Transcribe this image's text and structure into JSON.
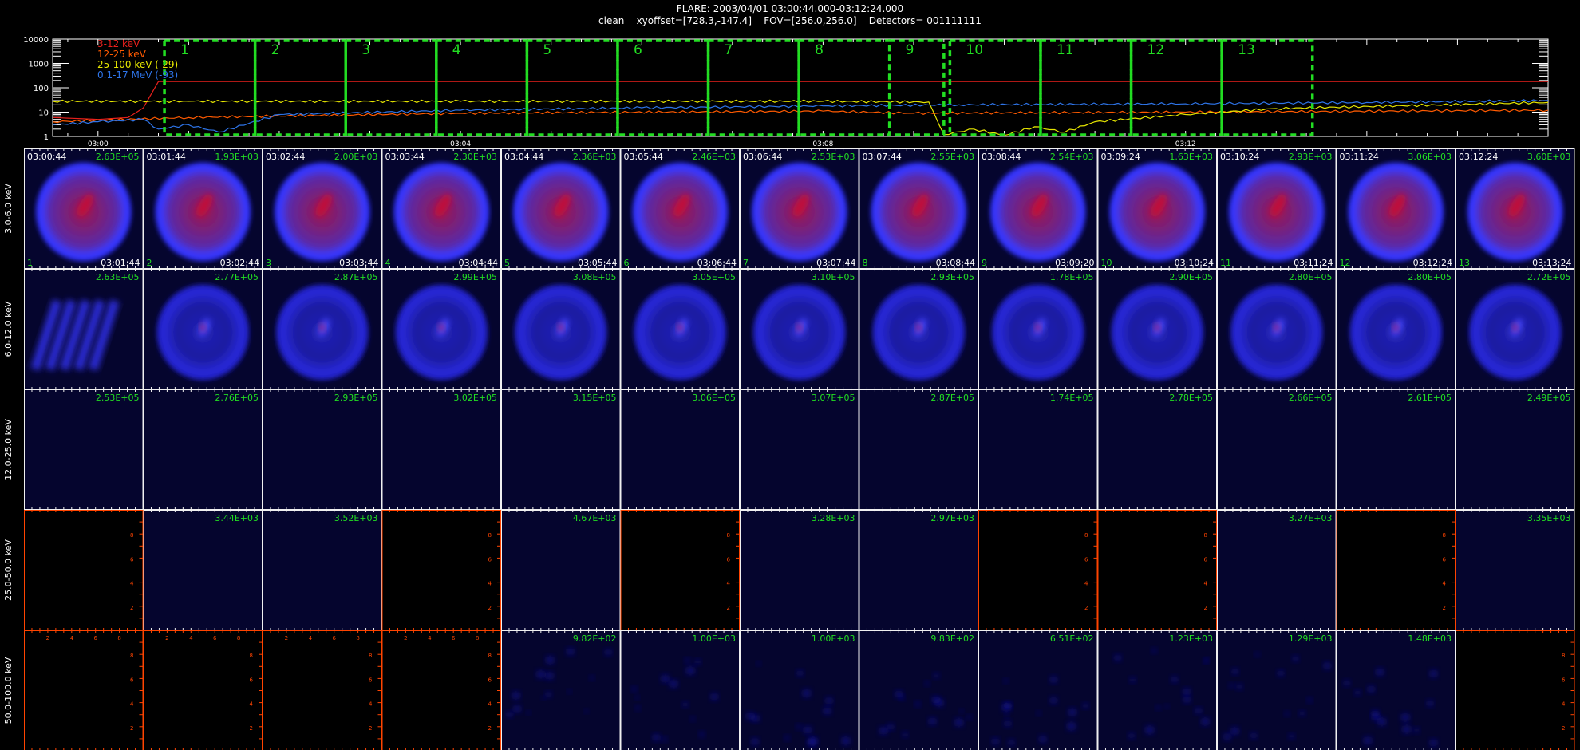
{
  "header": {
    "line1": "FLARE: 2003/04/01 03:00:44.000-03:12:24.000",
    "line2": "clean    xyoffset=[728.3,-147.4]    FOV=[256.0,256.0]    Detectors= 001111111"
  },
  "colors": {
    "axis": "#ffffff",
    "box": "#22dd22",
    "label_green": "#22dd22",
    "frame_orange": "#ff4400",
    "disk_blue": "#2a2aff"
  },
  "chart_data": [
    {
      "type": "line",
      "ylog": true,
      "ylim": [
        1,
        10000
      ],
      "y_ticks": [
        "10000",
        "1000",
        "100",
        "10",
        "1"
      ],
      "xlim": [
        "02:59:30",
        "03:16:00"
      ],
      "x_ticks": [
        "03:00",
        "03:04",
        "03:08",
        "03:12"
      ],
      "legend_position": "top-left",
      "legend": [
        {
          "label": "3-12 keV",
          "color": "#e8201c"
        },
        {
          "label": "12-25 keV",
          "color": "#ff5a00"
        },
        {
          "label": "25-100 keV (-29)",
          "color": "#e6e600"
        },
        {
          "label": "0.1-17 MeV (-93)",
          "color": "#2e74e8"
        }
      ],
      "series": [
        {
          "name": "3-12 keV",
          "color": "#e8201c",
          "x": [
            "02:59:30",
            "03:00:00",
            "03:00:20",
            "03:00:30",
            "03:00:40",
            "03:16:00"
          ],
          "y": [
            6,
            5,
            6,
            15,
            180,
            180
          ]
        },
        {
          "name": "12-25 keV",
          "color": "#ff5a00",
          "x": [
            "02:59:30",
            "03:01:00",
            "03:04:00",
            "03:08:00",
            "03:09:00",
            "03:12:00",
            "03:16:00"
          ],
          "y": [
            4,
            6,
            9,
            11,
            9,
            10,
            12
          ]
        },
        {
          "name": "25-100 keV (-29)",
          "color": "#e6e600",
          "x": [
            "02:59:30",
            "03:01:00",
            "03:04:00",
            "03:08:00",
            "03:09:10",
            "03:09:20",
            "03:09:40",
            "03:10:00",
            "03:10:20",
            "03:10:40",
            "03:11:00",
            "03:12:00",
            "03:13:00",
            "03:16:00"
          ],
          "y": [
            28,
            28,
            28,
            28,
            26,
            1.2,
            2,
            1.1,
            2.5,
            1.5,
            4,
            8,
            14,
            25
          ]
        },
        {
          "name": "0.1-17 MeV (-93)",
          "color": "#2e74e8",
          "x": [
            "02:59:30",
            "03:00:00",
            "03:00:30",
            "03:00:40",
            "03:01:00",
            "03:01:20",
            "03:02:00",
            "03:04:00",
            "03:06:00",
            "03:08:00",
            "03:09:30",
            "03:12:00",
            "03:14:00",
            "03:16:00"
          ],
          "y": [
            3,
            4,
            5,
            2,
            3,
            1.5,
            8,
            12,
            15,
            18,
            20,
            22,
            25,
            30
          ]
        }
      ],
      "intervals": [
        {
          "label": "1",
          "start": "03:00:44",
          "end": "03:01:44"
        },
        {
          "label": "2",
          "start": "03:01:44",
          "end": "03:02:44"
        },
        {
          "label": "3",
          "start": "03:02:44",
          "end": "03:03:44"
        },
        {
          "label": "4",
          "start": "03:03:44",
          "end": "03:04:44"
        },
        {
          "label": "5",
          "start": "03:04:44",
          "end": "03:05:44"
        },
        {
          "label": "6",
          "start": "03:05:44",
          "end": "03:06:44"
        },
        {
          "label": "7",
          "start": "03:06:44",
          "end": "03:07:44"
        },
        {
          "label": "8",
          "start": "03:07:44",
          "end": "03:08:44"
        },
        {
          "label": "9",
          "start": "03:08:44",
          "end": "03:09:20"
        },
        {
          "label": "10",
          "start": "03:09:24",
          "end": "03:10:24"
        },
        {
          "label": "11",
          "start": "03:10:24",
          "end": "03:11:24"
        },
        {
          "label": "12",
          "start": "03:11:24",
          "end": "03:12:24"
        },
        {
          "label": "13",
          "start": "03:12:24",
          "end": "03:13:24"
        }
      ]
    },
    {
      "type": "heatmap",
      "energy_bands": [
        "3.0-6.0 keV",
        "6.0-12.0 keV",
        "12.0-25.0 keV",
        "25.0-50.0 keV",
        "50.0-100.0 keV"
      ],
      "intervals": [
        {
          "index": "1",
          "start": "03:00:44",
          "end": "03:01:44"
        },
        {
          "index": "2",
          "start": "03:01:44",
          "end": "03:02:44"
        },
        {
          "index": "3",
          "start": "03:02:44",
          "end": "03:03:44"
        },
        {
          "index": "4",
          "start": "03:03:44",
          "end": "03:04:44"
        },
        {
          "index": "5",
          "start": "03:04:44",
          "end": "03:05:44"
        },
        {
          "index": "6",
          "start": "03:05:44",
          "end": "03:06:44"
        },
        {
          "index": "7",
          "start": "03:06:44",
          "end": "03:07:44"
        },
        {
          "index": "8",
          "start": "03:07:44",
          "end": "03:08:44"
        },
        {
          "index": "9",
          "start": "03:08:44",
          "end": "03:09:20"
        },
        {
          "index": "10",
          "start": "03:09:24",
          "end": "03:10:24"
        },
        {
          "index": "11",
          "start": "03:10:24",
          "end": "03:11:24"
        },
        {
          "index": "12",
          "start": "03:11:24",
          "end": "03:12:24"
        },
        {
          "index": "13",
          "start": "03:12:24",
          "end": "03:13:24"
        }
      ],
      "max_values": [
        [
          "2.63E+05",
          "1.93E+03",
          "2.00E+03",
          "2.30E+03",
          "2.36E+03",
          "2.46E+03",
          "2.53E+03",
          "2.55E+03",
          "2.54E+03",
          "1.63E+03",
          "2.93E+03",
          "3.06E+03",
          "3.60E+03"
        ],
        [
          "2.63E+05",
          "2.77E+05",
          "2.87E+05",
          "2.99E+05",
          "3.08E+05",
          "3.05E+05",
          "3.10E+05",
          "2.93E+05",
          "1.78E+05",
          "2.90E+05",
          "2.80E+05",
          "2.80E+05",
          "2.72E+05"
        ],
        [
          "2.53E+05",
          "2.76E+05",
          "2.93E+05",
          "3.02E+05",
          "3.15E+05",
          "3.06E+05",
          "3.07E+05",
          "2.87E+05",
          "1.74E+05",
          "2.78E+05",
          "2.66E+05",
          "2.61E+05",
          "2.49E+05"
        ],
        [
          "",
          "3.44E+03",
          "3.52E+03",
          "",
          "4.67E+03",
          "",
          "3.28E+03",
          "2.97E+03",
          "",
          "",
          "3.27E+03",
          "",
          "3.35E+03"
        ],
        [
          "",
          "",
          "",
          "",
          "9.82E+02",
          "1.00E+03",
          "1.00E+03",
          "9.83E+02",
          "6.51E+02",
          "1.23E+03",
          "1.29E+03",
          "1.48E+03",
          ""
        ]
      ],
      "panel_kind": [
        [
          "disk_red",
          "disk_red",
          "disk_red",
          "disk_red",
          "disk_red",
          "disk_red",
          "disk_red",
          "disk_red",
          "disk_red",
          "disk_red",
          "disk_red",
          "disk_red",
          "disk_red"
        ],
        [
          "stripes",
          "disk_blue",
          "disk_blue",
          "disk_blue",
          "disk_blue",
          "disk_blue",
          "disk_blue",
          "disk_blue",
          "disk_blue",
          "disk_blue",
          "disk_blue",
          "disk_blue",
          "disk_blue"
        ],
        [
          "flat",
          "flat",
          "flat",
          "flat",
          "flat",
          "flat",
          "flat",
          "flat",
          "flat",
          "flat",
          "flat",
          "flat",
          "flat"
        ],
        [
          "empty",
          "flat",
          "flat",
          "empty",
          "flat",
          "empty",
          "flat",
          "flat",
          "empty",
          "empty",
          "flat",
          "empty",
          "flat"
        ],
        [
          "empty",
          "empty",
          "empty",
          "empty",
          "noise",
          "noise",
          "noise",
          "noise",
          "noise",
          "noise",
          "noise",
          "noise",
          "empty"
        ]
      ],
      "empty_axis_ticks": [
        "2",
        "4",
        "6",
        "8"
      ]
    }
  ]
}
